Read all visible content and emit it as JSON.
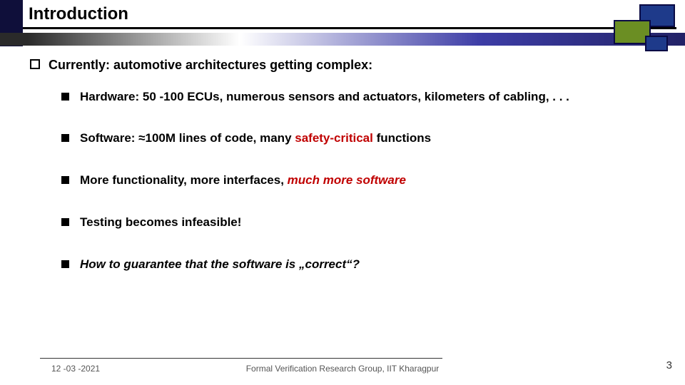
{
  "title": "Introduction",
  "heading": "Currently: automotive architectures getting complex:",
  "items": [
    {
      "pre": "Hardware: 50 -100 ECUs, numerous sensors and actuators, kilometers of cabling, . . .",
      "red": "",
      "post": "",
      "italic": false
    },
    {
      "pre": "Software: ≈100M lines of code, many ",
      "red": "safety-critical",
      "post": "  functions",
      "italic": false
    },
    {
      "pre": "More functionality, more interfaces, ",
      "red": "much more software",
      "post": "",
      "italic": false,
      "redItalic": true
    },
    {
      "pre": "Testing becomes infeasible!",
      "red": "",
      "post": "",
      "italic": false
    },
    {
      "pre": "How to guarantee that the software is „correct“?",
      "red": "",
      "post": "",
      "italic": true
    }
  ],
  "footer": {
    "date": "12 -03 -2021",
    "center": "Formal Verification Research Group, IIT Kharagpur",
    "page": "3"
  }
}
